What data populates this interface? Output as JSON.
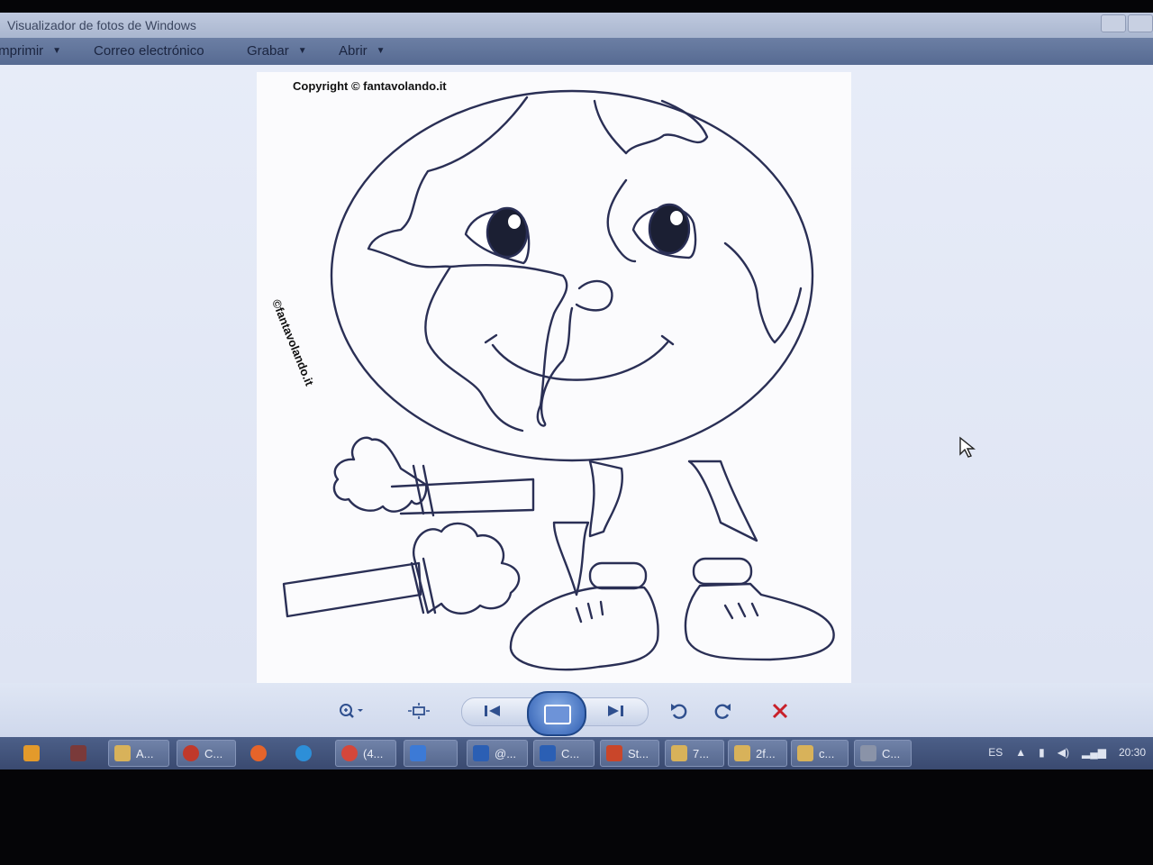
{
  "window": {
    "title": "Visualizador de fotos de Windows"
  },
  "menubar": {
    "items": [
      {
        "label": "Imprimir"
      },
      {
        "label": "Correo electrónico"
      },
      {
        "label": "Grabar"
      },
      {
        "label": "Abrir"
      }
    ]
  },
  "image": {
    "copyright": "Copyright © fantavolando.it",
    "side_watermark": "©fantavolando.it"
  },
  "controls": {
    "icons": [
      "zoom-icon",
      "fit-window-icon",
      "previous-icon",
      "slideshow-icon",
      "next-icon",
      "rotate-left-icon",
      "rotate-right-icon",
      "delete-icon"
    ]
  },
  "taskbar": {
    "items": [
      {
        "icon": "media-player-icon",
        "label": ""
      },
      {
        "icon": "app-icon",
        "label": ""
      },
      {
        "icon": "folder-icon",
        "label": "A..."
      },
      {
        "icon": "browser-icon",
        "label": "C..."
      },
      {
        "icon": "firefox-icon",
        "label": ""
      },
      {
        "icon": "edge-icon",
        "label": ""
      },
      {
        "icon": "chrome-icon",
        "label": "(4..."
      },
      {
        "icon": "photo-viewer-icon",
        "label": ""
      },
      {
        "icon": "word-icon",
        "label": "@..."
      },
      {
        "icon": "word-icon",
        "label": "C..."
      },
      {
        "icon": "powerpoint-icon",
        "label": "St..."
      },
      {
        "icon": "folder-icon",
        "label": "7..."
      },
      {
        "icon": "folder-icon",
        "label": "2f..."
      },
      {
        "icon": "folder-icon",
        "label": "c..."
      },
      {
        "icon": "app-icon",
        "label": "C..."
      }
    ],
    "tray": {
      "language": "ES",
      "clock": "20:30"
    }
  }
}
